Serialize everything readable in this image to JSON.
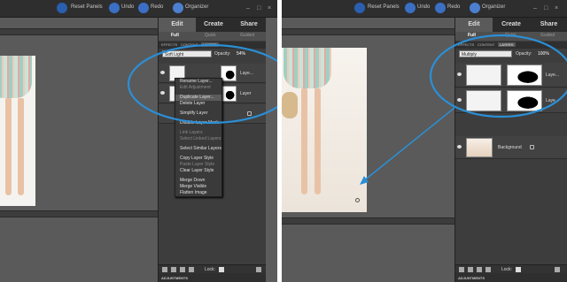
{
  "topbar": {
    "reset_panels": "Reset Panels",
    "undo": "Undo",
    "redo": "Redo",
    "organizer": "Organizer"
  },
  "tabs": {
    "edit": "Edit",
    "create": "Create",
    "share": "Share"
  },
  "subtabs": {
    "full": "Full",
    "quick": "Quick",
    "guided": "Guided"
  },
  "panel_tabs": {
    "effects": "EFFECTS",
    "content": "CONTENT",
    "layers": "LAYERS"
  },
  "left_panel": {
    "blend_mode": "Soft Light",
    "opacity_label": "Opacity:",
    "opacity_value": "54%",
    "layers": [
      {
        "name": "Laye..."
      },
      {
        "name": "Layer"
      },
      {
        "name": ""
      }
    ],
    "lock_label": "Lock:"
  },
  "right_panel": {
    "blend_mode": "Multiply",
    "opacity_label": "Opacity:",
    "opacity_value": "100%",
    "layers": [
      {
        "name": "Laye..."
      },
      {
        "name": "Laye..."
      },
      {
        "name": "Background"
      }
    ],
    "lock_label": "Lock:"
  },
  "context_menu": {
    "items": [
      {
        "label": "Rename Layer...",
        "disabled": false
      },
      {
        "label": "Edit Adjustment",
        "disabled": true
      },
      {
        "label": "",
        "gap": true
      },
      {
        "label": "Duplicate Layer...",
        "disabled": false,
        "active": true
      },
      {
        "label": "Delete Layer",
        "disabled": false
      },
      {
        "label": "",
        "gap": true
      },
      {
        "label": "Simplify Layer",
        "disabled": false
      },
      {
        "label": "",
        "gap": true
      },
      {
        "label": "Disable Layer Mask",
        "disabled": false
      },
      {
        "label": "",
        "gap": true
      },
      {
        "label": "Link Layers",
        "disabled": true
      },
      {
        "label": "Select Linked Layers",
        "disabled": true
      },
      {
        "label": "",
        "gap": true
      },
      {
        "label": "Select Similar Layers",
        "disabled": false
      },
      {
        "label": "",
        "gap": true
      },
      {
        "label": "Copy Layer Style",
        "disabled": false
      },
      {
        "label": "Paste Layer Style",
        "disabled": true
      },
      {
        "label": "Clear Layer Style",
        "disabled": false
      },
      {
        "label": "",
        "gap": true
      },
      {
        "label": "Merge Down",
        "disabled": false
      },
      {
        "label": "Merge Visible",
        "disabled": false
      },
      {
        "label": "Flatten Image",
        "disabled": false
      }
    ]
  },
  "adjustments_label": "ADJUSTMENTS",
  "colors": {
    "highlight_circle": "#2b8fd6",
    "app_blue": "#2a5fb0"
  }
}
